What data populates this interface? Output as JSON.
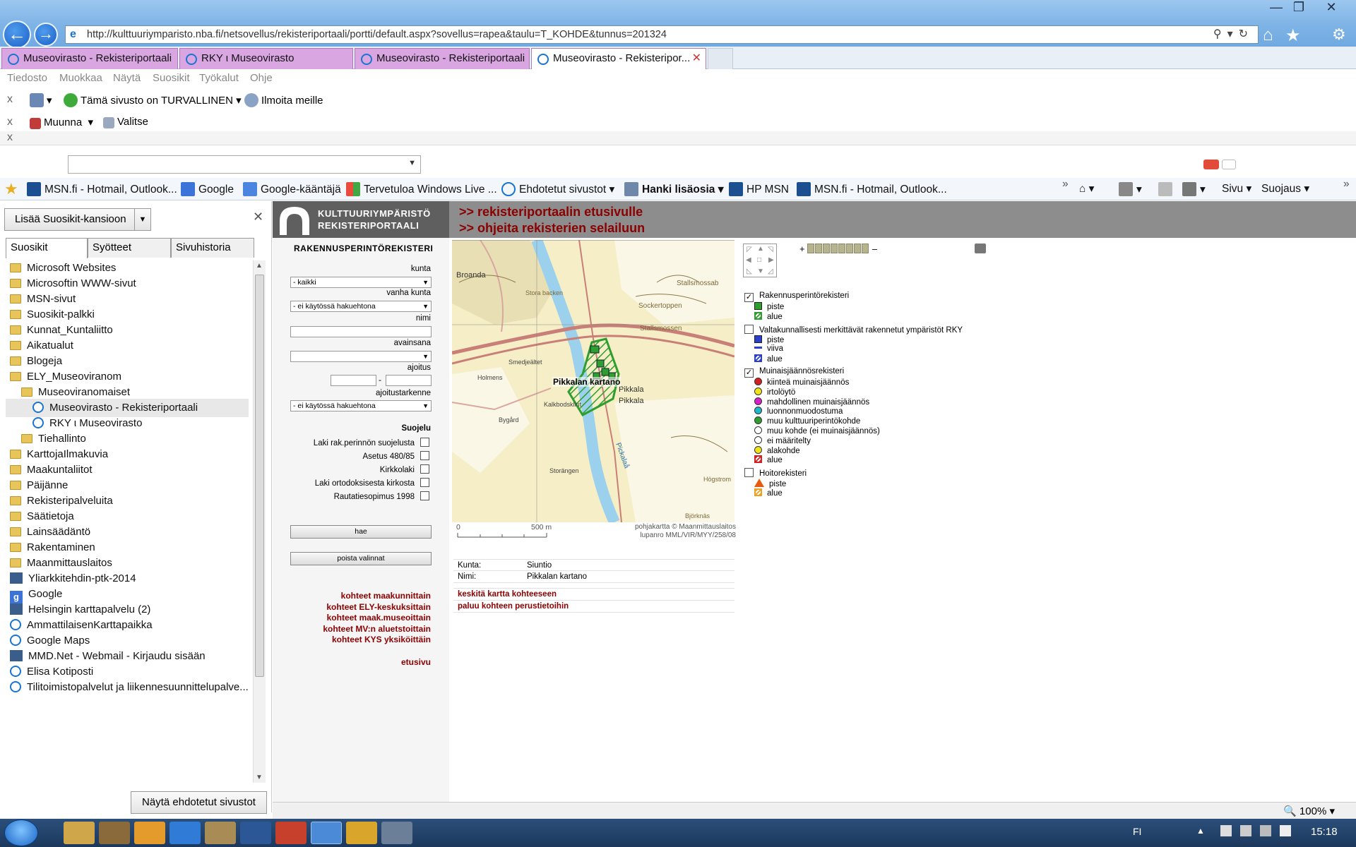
{
  "browser": {
    "address": "http://kulttuuriymparisto.nba.fi/netsovellus/rekisteriportaali/portti/default.aspx?sovellus=rapea&taulu=T_KOHDE&tunnus=201324",
    "tabs": [
      {
        "label": "Museovirasto - Rekisteriportaali",
        "active": false
      },
      {
        "label": "RKY  ι  Museovirasto",
        "active": false
      },
      {
        "label": "Museovirasto - Rekisteriportaali",
        "active": false
      },
      {
        "label": "Museovirasto - Rekisteripor...",
        "active": true
      }
    ],
    "tab_close": "✕",
    "menu": [
      "Tiedosto",
      "Muokkaa",
      "Näytä",
      "Suosikit",
      "Työkalut",
      "Ohje"
    ],
    "toolbar1": {
      "safety": "Tämä sivusto on TURVALLINEN",
      "report": "Ilmoita meille"
    },
    "toolbar2": {
      "convert": "Muunna",
      "select": "Valitse"
    },
    "close_x": "x",
    "favbar": {
      "items": [
        "MSN.fi - Hotmail, Outlook...",
        "Google",
        "Google-kääntäjä",
        "Tervetuloa Windows Live ...",
        "Ehdotetut sivustot",
        "Hanki lisäosia",
        "HP   MSN",
        "MSN.fi - Hotmail, Outlook..."
      ],
      "right": [
        "Sivu",
        "Suojaus"
      ]
    }
  },
  "favorites_panel": {
    "add_button": "Lisää Suosikit-kansioon",
    "tabs": [
      "Suosikit",
      "Syötteet",
      "Sivuhistoria"
    ],
    "items": [
      {
        "label": "Microsoft Websites",
        "type": "folder",
        "indent": 0
      },
      {
        "label": "Microsoftin WWW-sivut",
        "type": "folder",
        "indent": 0
      },
      {
        "label": "MSN-sivut",
        "type": "folder",
        "indent": 0
      },
      {
        "label": "Suosikit-palkki",
        "type": "folder",
        "indent": 0
      },
      {
        "label": "Kunnat_Kuntaliitto",
        "type": "folder",
        "indent": 0
      },
      {
        "label": "Aikatualut",
        "type": "folder",
        "indent": 0
      },
      {
        "label": "Blogeja",
        "type": "folder",
        "indent": 0
      },
      {
        "label": "ELY_Museoviranom",
        "type": "folder",
        "indent": 0
      },
      {
        "label": "Museoviranomaiset",
        "type": "folder",
        "indent": 1
      },
      {
        "label": "Museovirasto - Rekisteriportaali",
        "type": "page",
        "indent": 2,
        "selected": true
      },
      {
        "label": "RKY  ι  Museovirasto",
        "type": "page",
        "indent": 2
      },
      {
        "label": "Tiehallinto",
        "type": "folder",
        "indent": 1
      },
      {
        "label": "KarttojaIlmakuvia",
        "type": "folder",
        "indent": 0
      },
      {
        "label": "Maakuntaliitot",
        "type": "folder",
        "indent": 0
      },
      {
        "label": "Päijänne",
        "type": "folder",
        "indent": 0
      },
      {
        "label": "Rekisteripalveluita",
        "type": "folder",
        "indent": 0
      },
      {
        "label": "Säätietoja",
        "type": "folder",
        "indent": 0
      },
      {
        "label": "Lainsäädäntö",
        "type": "folder",
        "indent": 0
      },
      {
        "label": "Rakentaminen",
        "type": "folder",
        "indent": 0
      },
      {
        "label": "Maanmittauslaitos",
        "type": "folder",
        "indent": 0
      },
      {
        "label": "Yliarkkitehdin-ptk-2014",
        "type": "square",
        "indent": 0
      },
      {
        "label": "Google",
        "type": "google",
        "indent": 0
      },
      {
        "label": "Helsingin karttapalvelu (2)",
        "type": "square",
        "indent": 0
      },
      {
        "label": "AmmattilaisenKarttapaikka",
        "type": "page",
        "indent": 0
      },
      {
        "label": "Google Maps",
        "type": "page",
        "indent": 0
      },
      {
        "label": "MMD.Net - Webmail - Kirjaudu sisään",
        "type": "square",
        "indent": 0
      },
      {
        "label": "Elisa Kotiposti",
        "type": "page",
        "indent": 0
      },
      {
        "label": "Tilitoimistopalvelut ja liikennesuunnittelupalve...",
        "type": "page",
        "indent": 0
      }
    ],
    "suggest_button": "Näytä ehdotetut sivustot"
  },
  "portal": {
    "logo_line1": "KULTTUURIYMPÄRISTÖ",
    "logo_line2": "REKISTERIPORTAALI",
    "link_home": ">> rekisteriportaalin etusivulle",
    "link_help": ">> ohjeita rekisterien selailuun",
    "form": {
      "title": "RAKENNUSPERINTÖREKISTERI",
      "kunta_label": "kunta",
      "kunta_value": "- kaikki",
      "vanha_kunta_label": "vanha kunta",
      "vanha_kunta_value": "- ei käytössä hakuehtona",
      "nimi_label": "nimi",
      "avainsana_label": "avainsana",
      "ajoitus_label": "ajoitus",
      "ajoitus_sep": "-",
      "ajoitustarkenne_label": "ajoitustarkenne",
      "ajoitustarkenne_value": "- ei käytössä hakuehtona",
      "suojelu_label": "Suojelu",
      "suojelu_items": [
        "Laki rak.perinnön suojelusta",
        "Asetus 480/85",
        "Kirkkolaki",
        "Laki ortodoksisesta kirkosta",
        "Rautatiesopimus 1998"
      ],
      "search_button": "hae",
      "clear_button": "poista valinnat",
      "links": [
        "kohteet maakunnittain",
        "kohteet ELY-keskuksittain",
        "kohteet maak.museoittain",
        "kohteet MV:n aluetstoittain",
        "kohteet KYS yksiköittäin"
      ],
      "home_link": "etusivu"
    },
    "map": {
      "place_labels": [
        "Broanda",
        "Stora backen",
        "Stallsmossab",
        "Sockertoppen",
        "Stallsmossen",
        "Smedjeältet",
        "Holmens",
        "Kalkbodsklint",
        "Pikkala",
        "Pikkala",
        "Bygård",
        "Pickalaå",
        "Storängen",
        "Högstrom",
        "Björknäs"
      ],
      "object_label": "Pikkalan kartano",
      "scale_zero": "0",
      "scale_500": "500 m",
      "copyright1": "pohjakartta © Maanmittauslaitos",
      "copyright2": "lupanro MML/VIR/MYY/258/08",
      "zoom_plus": "+",
      "zoom_minus": "–"
    },
    "info": {
      "kunta_key": "Kunta:",
      "kunta_value": "Siuntio",
      "nimi_key": "Nimi:",
      "nimi_value": "Pikkalan kartano",
      "link_center": "keskitä kartta kohteeseen",
      "link_back": "paluu kohteen perustietoihin"
    },
    "legend": {
      "groups": [
        {
          "title": "Rakennusperintörekisteri",
          "checked": true,
          "items": [
            {
              "label": "piste",
              "symbol": "square",
              "color": "#2e9e2e"
            },
            {
              "label": "alue",
              "symbol": "hatch",
              "color": "#2e9e2e"
            }
          ]
        },
        {
          "title": "Valtakunnallisesti merkittävät rakennetut ympäristöt RKY",
          "checked": false,
          "items": [
            {
              "label": "piste",
              "symbol": "square",
              "color": "#2b3fcf"
            },
            {
              "label": "viiva",
              "symbol": "line",
              "color": "#2b3fcf"
            },
            {
              "label": "alue",
              "symbol": "hatch",
              "color": "#2b3fcf"
            }
          ]
        },
        {
          "title": "Muinaisjäännösrekisteri",
          "checked": true,
          "items": [
            {
              "label": "kiinteä muinaisjäännös",
              "symbol": "dot",
              "color": "#d42020"
            },
            {
              "label": "irtolöytö",
              "symbol": "dot",
              "color": "#f2e21a"
            },
            {
              "label": "mahdollinen muinaisjäännös",
              "symbol": "dot",
              "color": "#d820c8"
            },
            {
              "label": "luonnonmuodostuma",
              "symbol": "dot",
              "color": "#1fb8c9"
            },
            {
              "label": "muu kulttuuriperintökohde",
              "symbol": "dot",
              "color": "#2e9e2e"
            },
            {
              "label": "muu kohde (ei muinaisjäännös)",
              "symbol": "dot",
              "color": "#ffffff"
            },
            {
              "label": "ei määritelty",
              "symbol": "dot",
              "color": "#ffffff"
            },
            {
              "label": "alakohde",
              "symbol": "dot",
              "color": "#f2e21a"
            },
            {
              "label": "alue",
              "symbol": "hatch",
              "color": "#d42020"
            }
          ]
        },
        {
          "title": "Hoitorekisteri",
          "checked": false,
          "items": [
            {
              "label": "piste",
              "symbol": "triangle",
              "color": "#e85a10"
            },
            {
              "label": "alue",
              "symbol": "hatch",
              "color": "#f0a020"
            }
          ]
        }
      ]
    }
  },
  "status": {
    "zoom": "100%"
  },
  "taskbar": {
    "lang": "FI",
    "clock": "15:18"
  }
}
